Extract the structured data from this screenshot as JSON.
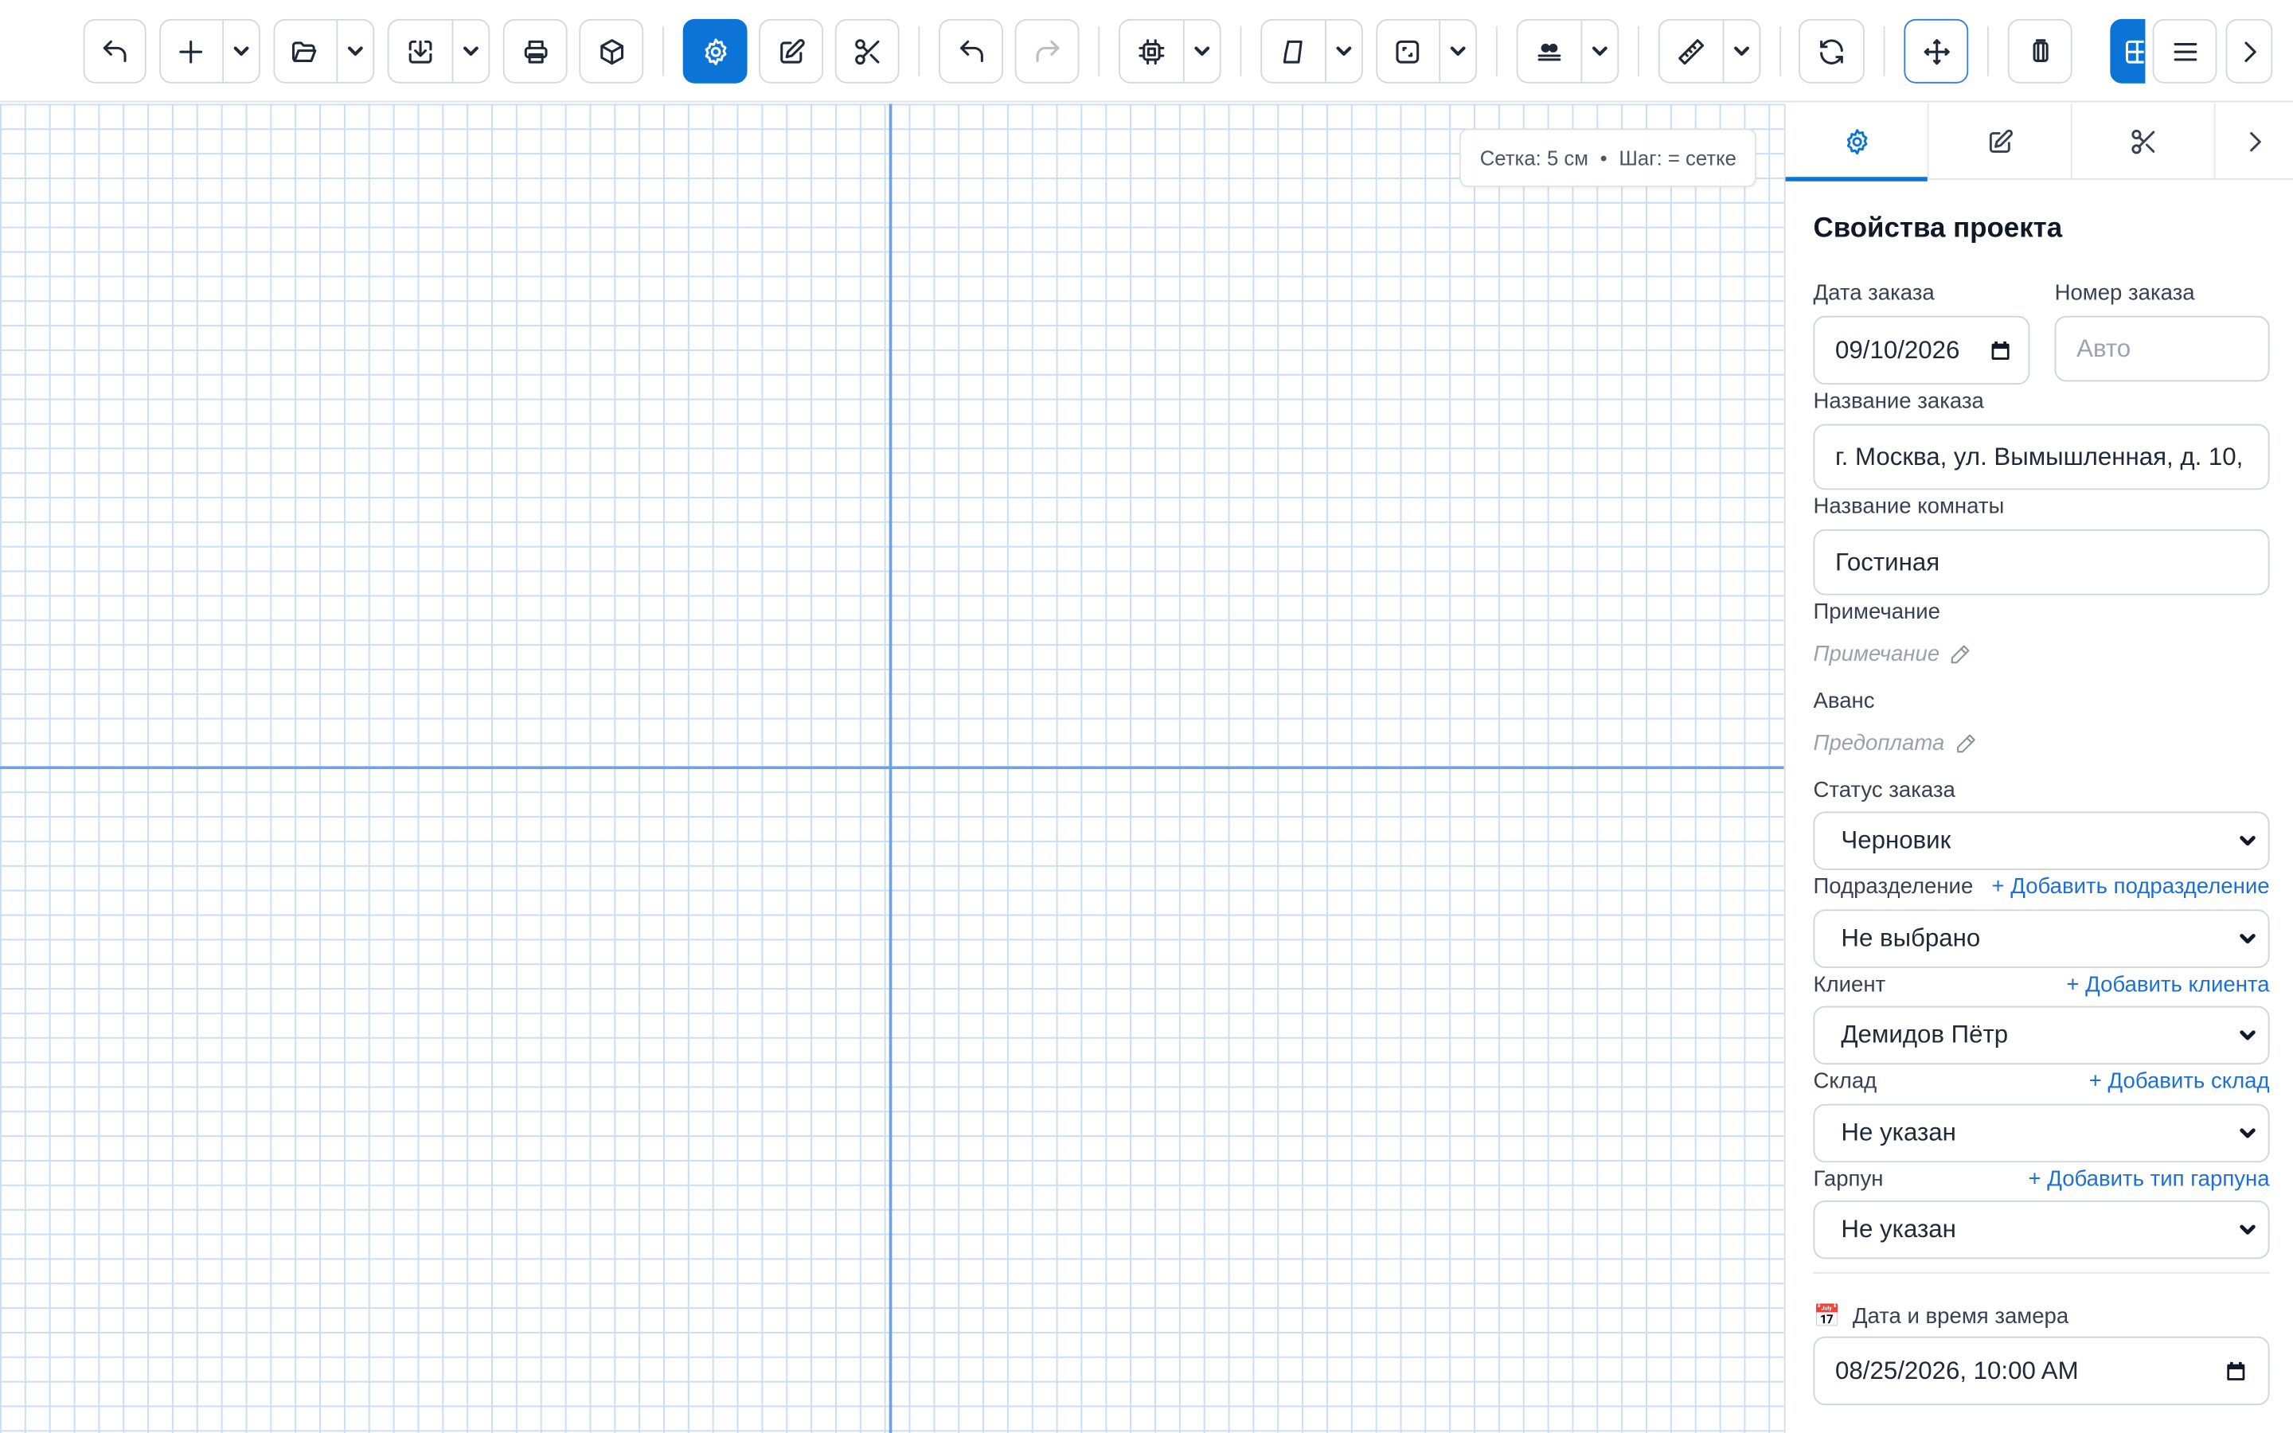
{
  "toolbar": {
    "icons": [
      "undo-icon",
      "plus-icon",
      "folder-open-icon",
      "download-icon",
      "printer-icon",
      "cube-icon",
      "gear-icon",
      "edit-icon",
      "scissors-icon",
      "undo-icon",
      "redo-icon",
      "cpu-icon",
      "wall-icon",
      "room-shape-icon",
      "align-icon",
      "ruler-icon",
      "refresh-icon",
      "move-icon",
      "panels-icon",
      "layout-icon",
      "menu-icon",
      "chevron-right-icon"
    ],
    "accent_color": "#0b74d6"
  },
  "canvas": {
    "grid_info": {
      "grid_label": "Сетка: 5 см",
      "separator": "•",
      "step_label": "Шаг: = сетке"
    },
    "grid_color": "#c9def7",
    "axis_color": "#6aa3e8"
  },
  "panel": {
    "tabs": [
      "settings",
      "edit",
      "cut",
      "more"
    ],
    "title": "Свойства проекта",
    "order_date": {
      "label": "Дата заказа",
      "value": "09/10/2026"
    },
    "order_number": {
      "label": "Номер заказа",
      "placeholder": "Авто"
    },
    "order_name": {
      "label": "Название заказа",
      "value": "г. Москва, ул. Вымышленная, д. 10,"
    },
    "room_name": {
      "label": "Название комнаты",
      "value": "Гостиная"
    },
    "note": {
      "label": "Примечание",
      "placeholder": "Примечание"
    },
    "advance": {
      "label": "Аванс",
      "placeholder": "Предоплата"
    },
    "status": {
      "label": "Статус заказа",
      "value": "Черновик"
    },
    "division": {
      "label": "Подразделение",
      "add_link": "+ Добавить подразделение",
      "value": "Не выбрано"
    },
    "client": {
      "label": "Клиент",
      "add_link": "+ Добавить клиента",
      "value": "Демидов Пётр"
    },
    "warehouse": {
      "label": "Склад",
      "add_link": "+ Добавить склад",
      "value": "Не указан"
    },
    "harpoon": {
      "label": "Гарпун",
      "add_link": "+ Добавить тип гарпуна",
      "value": "Не указан"
    },
    "measure_datetime": {
      "emoji": "📅",
      "label": "Дата и время замера",
      "value": "08/25/2026, 10:00 AM"
    }
  }
}
